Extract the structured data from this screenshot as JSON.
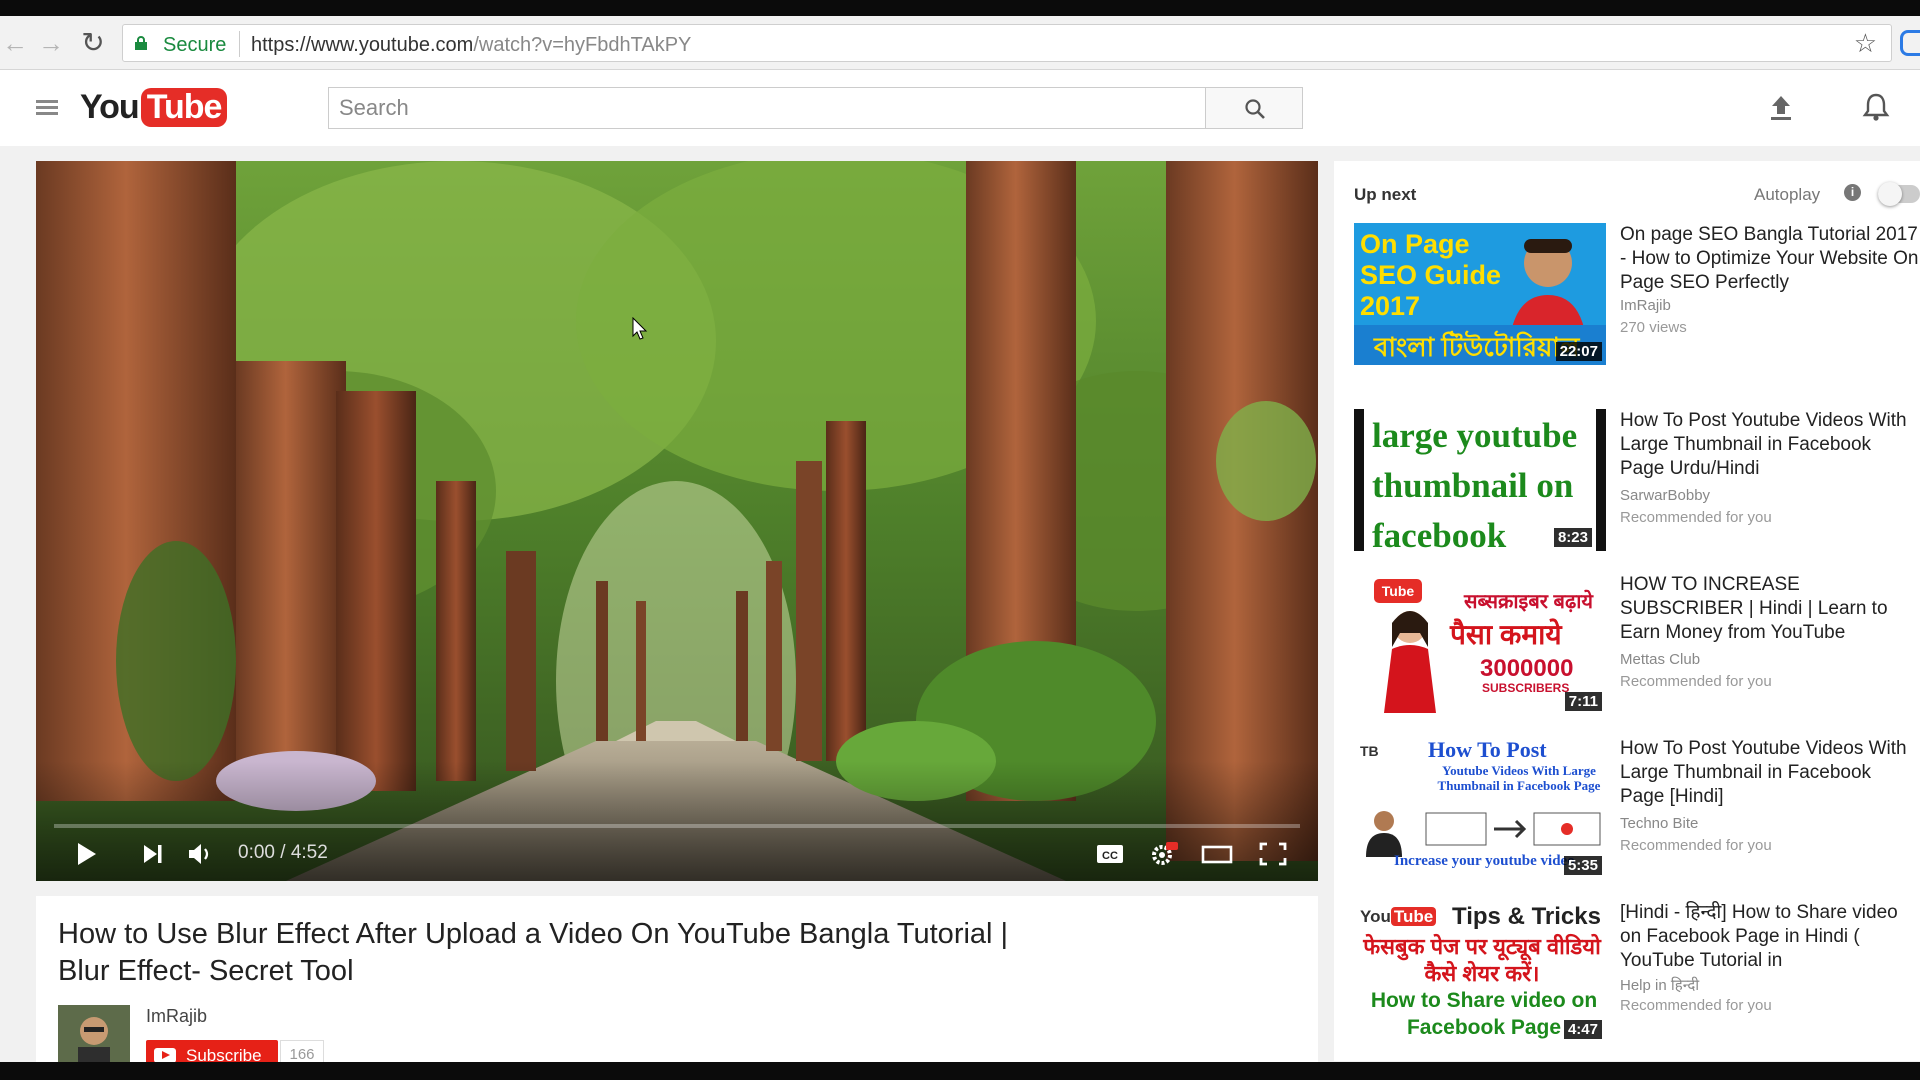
{
  "browser": {
    "secure_label": "Secure",
    "url_host": "https://www.youtube.com",
    "url_path": "/watch?v=hyFbdhTAkPY"
  },
  "header": {
    "logo_you": "You",
    "logo_tube": "Tube",
    "search_placeholder": "Search"
  },
  "player": {
    "time": "0:00 / 4:52",
    "progress": 0.0
  },
  "video": {
    "title": "How to Use Blur Effect After Upload a Video On YouTube Bangla Tutorial | Blur Effect- Secret Tool",
    "channel": "ImRajib",
    "subscribe_label": "Subscribe",
    "subscriber_count": "166"
  },
  "sidebar": {
    "up_next": "Up next",
    "autoplay": "Autoplay",
    "items": [
      {
        "title": "On page SEO Bangla Tutorial 2017 - How to Optimize Your Website On Page SEO Perfectly",
        "channel": "ImRajib",
        "meta": "270 views",
        "duration": "22:07",
        "thumb_text": [
          "On Page",
          "SEO Guide",
          "2017"
        ],
        "thumb_bangla": "বাংলা টিউটোরিয়াল"
      },
      {
        "title": "How To Post Youtube Videos With Large Thumbnail in Facebook Page Urdu/Hindi",
        "channel": "SarwarBobby",
        "meta": "Recommended for you",
        "duration": "8:23",
        "thumb_text": [
          "large youtube",
          "thumbnail on",
          "facebook"
        ]
      },
      {
        "title": "HOW TO INCREASE SUBSCRIBER | Hindi | Learn to Earn Money from YouTube",
        "channel": "Mettas Club",
        "meta": "Recommended for you",
        "duration": "7:11",
        "thumb_logo": "Tube",
        "thumb_line1": "सब्सक्राइबर बढ़ाये",
        "thumb_line2": "पैसा कमाये",
        "thumb_num": "3000000",
        "thumb_subs": "SUBSCRIBERS"
      },
      {
        "title": "How To Post Youtube Videos With Large Thumbnail in Facebook Page [Hindi]",
        "channel": "Techno Bite",
        "meta": "Recommended for you",
        "duration": "5:35",
        "thumb_tb": "TB",
        "thumb_head": "How To Post",
        "thumb_sub": "Youtube Videos With Large Thumbnail in Facebook Page",
        "thumb_foot": "Increase your youtube video"
      },
      {
        "title": "[Hindi - हिन्दी] How to Share video on Facebook Page in Hindi ( YouTube Tutorial in",
        "channel": "Help in हिन्दी",
        "meta": "Recommended for you",
        "duration": "4:47",
        "thumb_logo_you": "You",
        "thumb_logo_tube": "Tube",
        "thumb_tips": "Tips & Tricks",
        "thumb_hindi": "फेसबुक पेज पर यूट्यूब वीडियो कैसे शेयर करें।",
        "thumb_eng": "How to Share video on Facebook Page"
      }
    ]
  },
  "colors": {
    "accent_red": "#e52d27",
    "secure_green": "#1a8a3f"
  }
}
